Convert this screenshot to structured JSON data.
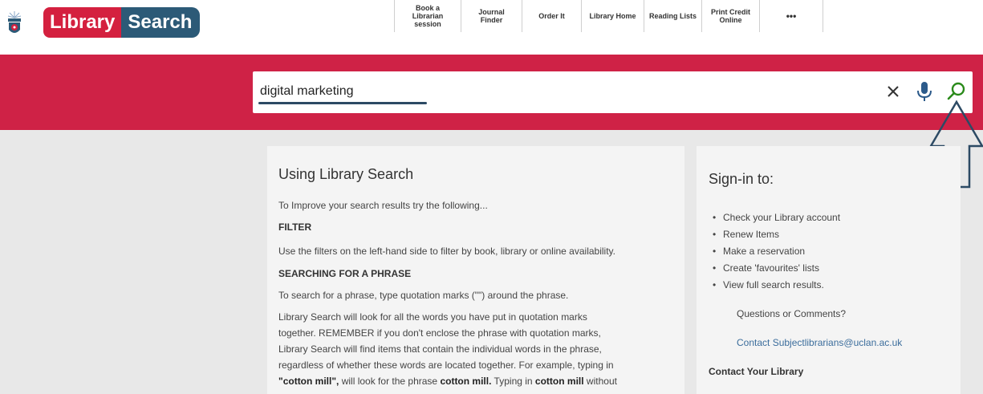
{
  "header": {
    "logo_text_1": "Library",
    "logo_text_2": "Search",
    "nav": [
      {
        "line1": "Book a",
        "line2": "Librarian",
        "line3": "session"
      },
      {
        "line1": "Journal",
        "line2": "Finder"
      },
      {
        "line1": "Order It"
      },
      {
        "line1": "Library Home"
      },
      {
        "line1": "Reading Lists"
      },
      {
        "line1": "Print Credit",
        "line2": "Online"
      },
      {
        "line1": "•••"
      }
    ]
  },
  "search": {
    "value": "digital marketing",
    "clear_glyph": "✕"
  },
  "left_card": {
    "title": "Using Library Search",
    "intro": "To Improve your search results try the following...",
    "filter_heading": "FILTER",
    "filter_text": "Use the filters on the left-hand side to filter by book, library or online availability.",
    "phrase_heading": "SEARCHING FOR A PHRASE",
    "phrase_text": "To search for a phrase, type quotation marks (\"\") around the phrase.",
    "para_lines": [
      "Library Search will look for all the words you have put in quotation marks",
      "together. REMEMBER if you don't enclose the phrase with quotation marks,",
      "Library Search will find items that contain the individual words in the phrase,",
      "regardless of whether these words are located together. For example, typing in"
    ],
    "last_line": {
      "a": "\"cotton mill\",",
      "b": " will look for the phrase ",
      "c": "cotton mill.",
      "d": " Typing in ",
      "e": "cotton mill",
      "f": " without"
    }
  },
  "right_card": {
    "title": "Sign-in to:",
    "items": [
      "Check your Library account",
      "Renew Items",
      "Make a reservation",
      "Create 'favourites' lists",
      "View full search results."
    ],
    "questions": "Questions or Comments?",
    "contact_link": "Contact Subjectlibrarians@uclan.ac.uk",
    "contact_heading": "Contact Your Library"
  },
  "colors": {
    "red_band": "#cf2246",
    "logo_red": "#d4203f",
    "logo_blue": "#2c5a77",
    "search_icon_green": "#2a8a1a",
    "mic_blue": "#2c5a8a",
    "arrow_outline": "#2c4a64"
  }
}
